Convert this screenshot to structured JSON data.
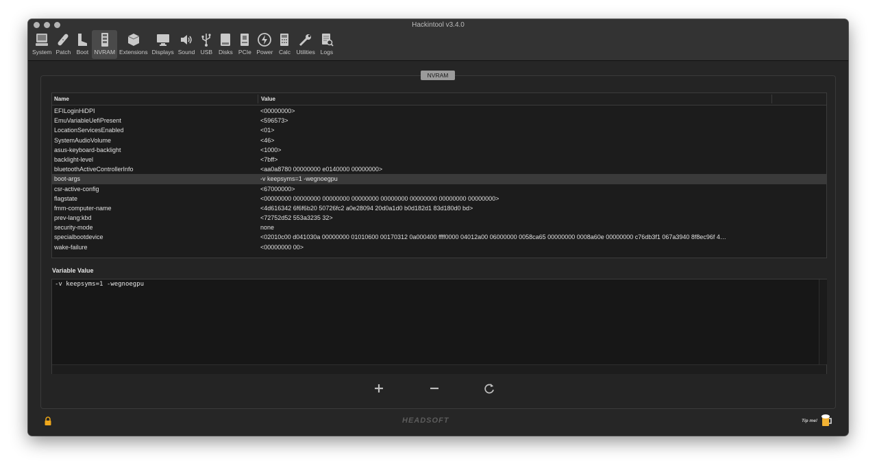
{
  "window": {
    "title": "Hackintool v3.4.0"
  },
  "toolbar": {
    "items": [
      {
        "label": "System",
        "icon": "system-icon"
      },
      {
        "label": "Patch",
        "icon": "patch-icon"
      },
      {
        "label": "Boot",
        "icon": "boot-icon"
      },
      {
        "label": "NVRAM",
        "icon": "nvram-icon",
        "active": true
      },
      {
        "label": "Extensions",
        "icon": "extensions-icon"
      },
      {
        "label": "Displays",
        "icon": "displays-icon"
      },
      {
        "label": "Sound",
        "icon": "sound-icon"
      },
      {
        "label": "USB",
        "icon": "usb-icon"
      },
      {
        "label": "Disks",
        "icon": "disks-icon"
      },
      {
        "label": "PCIe",
        "icon": "pcie-icon"
      },
      {
        "label": "Power",
        "icon": "power-icon"
      },
      {
        "label": "Calc",
        "icon": "calc-icon"
      },
      {
        "label": "Utilities",
        "icon": "utilities-icon"
      },
      {
        "label": "Logs",
        "icon": "logs-icon"
      }
    ]
  },
  "section": {
    "label": "NVRAM"
  },
  "table": {
    "headers": {
      "name": "Name",
      "value": "Value"
    },
    "rows": [
      {
        "name": "EFILoginHiDPI",
        "value": "<00000000>"
      },
      {
        "name": "EmuVariableUefiPresent",
        "value": "<596573>"
      },
      {
        "name": "LocationServicesEnabled",
        "value": "<01>"
      },
      {
        "name": "SystemAudioVolume",
        "value": "<46>"
      },
      {
        "name": "asus-keyboard-backlight",
        "value": "<1000>"
      },
      {
        "name": "backlight-level",
        "value": "<7bff>"
      },
      {
        "name": "bluetoothActiveControllerInfo",
        "value": "<aa0a8780 00000000 e0140000 00000000>"
      },
      {
        "name": "boot-args",
        "value": "-v keepsyms=1 -wegnoegpu",
        "selected": true
      },
      {
        "name": "csr-active-config",
        "value": "<67000000>"
      },
      {
        "name": "flagstate",
        "value": "<00000000 00000000 00000000 00000000 00000000 00000000 00000000 00000000>"
      },
      {
        "name": "fmm-computer-name",
        "value": "<4d616342 6f6f6b20 50726fc2 a0e28094 20d0a1d0 b0d182d1 83d180d0 bd>"
      },
      {
        "name": "prev-lang:kbd",
        "value": "<72752d52 553a3235 32>"
      },
      {
        "name": "security-mode",
        "value": "none"
      },
      {
        "name": "specialbootdevice",
        "value": "<02010c00 d041030a 00000000 01010600 00170312 0a000400 ffff0000 04012a00 06000000 0058ca65 00000000 0008a60e 00000000 c76db3f1 067a3940 8f8ec96f 4…"
      },
      {
        "name": "wake-failure",
        "value": "<00000000 00>"
      }
    ]
  },
  "variable": {
    "label": "Variable Value",
    "value": "-v keepsyms=1 -wegnoegpu"
  },
  "footer": {
    "brand": "HEADSOFT",
    "tip": "Tip me!"
  }
}
